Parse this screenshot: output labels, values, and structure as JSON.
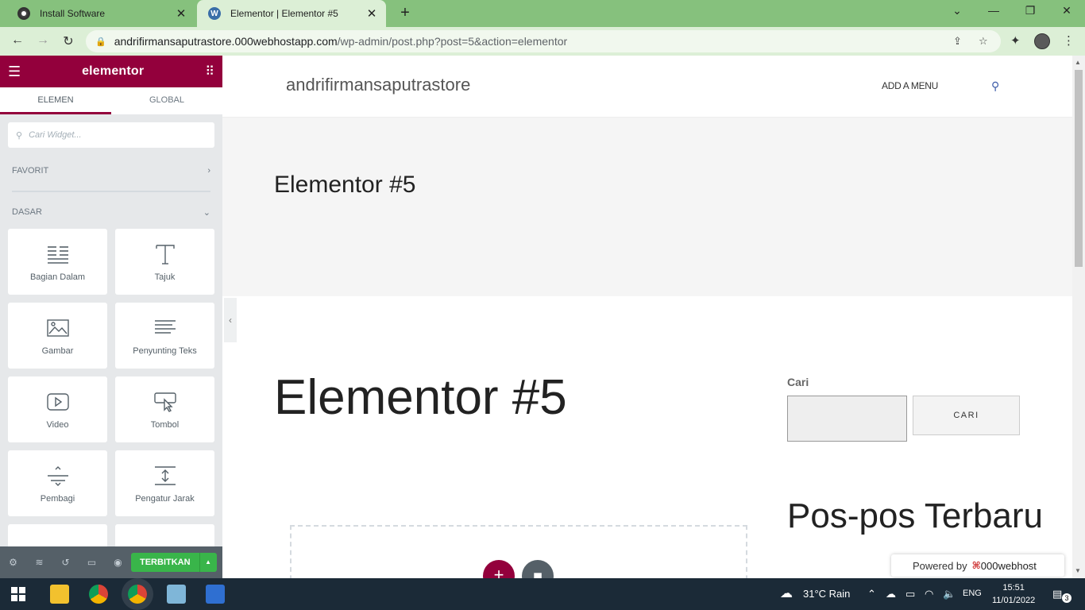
{
  "browser": {
    "tabs": [
      {
        "title": "Install Software",
        "icon": "chrome-tab-icon"
      },
      {
        "title": "Elementor | Elementor #5",
        "icon": "wordpress-icon",
        "active": true
      }
    ],
    "url_host": "andrifirmansaputrastore.000webhostapp.com",
    "url_path": "/wp-admin/post.php?post=5&action=elementor",
    "accent_color": "#86c17d"
  },
  "panel": {
    "logo": "elementor",
    "tabs": [
      "ELEMEN",
      "GLOBAL"
    ],
    "search_placeholder": "Cari Widget...",
    "favorites_label": "FAVORIT",
    "basic_label": "DASAR",
    "widgets": [
      {
        "label": "Bagian Dalam",
        "icon": "inner-section-icon"
      },
      {
        "label": "Tajuk",
        "icon": "heading-icon"
      },
      {
        "label": "Gambar",
        "icon": "image-icon"
      },
      {
        "label": "Penyunting Teks",
        "icon": "text-editor-icon"
      },
      {
        "label": "Video",
        "icon": "video-icon"
      },
      {
        "label": "Tombol",
        "icon": "button-icon"
      },
      {
        "label": "Pembagi",
        "icon": "divider-icon"
      },
      {
        "label": "Pengatur Jarak",
        "icon": "spacer-icon"
      }
    ],
    "publish_label": "TERBITKAN",
    "brand_color": "#93003c"
  },
  "site": {
    "title": "andrifirmansaputrastore",
    "menu_label": "ADD A MENU",
    "hero_title": "Elementor #5",
    "page_title": "Elementor #5",
    "search_label": "Cari",
    "search_button": "CARI",
    "recent_posts_title": "Pos-pos Terbaru",
    "powered_by": "Powered by",
    "powered_brand": "000webhost"
  },
  "taskbar": {
    "weather": "31°C  Rain",
    "language": "ENG",
    "time": "15:51",
    "date": "11/01/2022",
    "notifications": "3"
  }
}
